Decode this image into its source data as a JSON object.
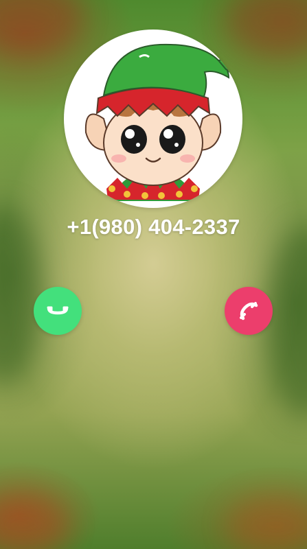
{
  "call": {
    "caller_number": "+1(980) 404-2337",
    "avatar": "elf-character-avatar"
  },
  "actions": {
    "accept": {
      "icon": "phone-handset-icon",
      "color": "#43e07c"
    },
    "decline": {
      "icon": "phone-handset-icon",
      "color": "#ec3e6c"
    }
  }
}
